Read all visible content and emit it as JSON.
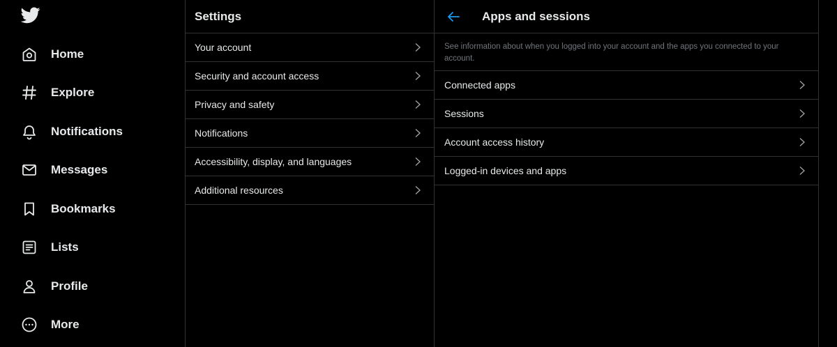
{
  "nav": {
    "logo_icon": "twitter-bird-icon",
    "items": [
      {
        "label": "Home",
        "icon": "home-icon"
      },
      {
        "label": "Explore",
        "icon": "hashtag-icon"
      },
      {
        "label": "Notifications",
        "icon": "bell-icon"
      },
      {
        "label": "Messages",
        "icon": "envelope-icon"
      },
      {
        "label": "Bookmarks",
        "icon": "bookmark-icon"
      },
      {
        "label": "Lists",
        "icon": "list-icon"
      },
      {
        "label": "Profile",
        "icon": "person-icon"
      },
      {
        "label": "More",
        "icon": "more-circle-icon"
      }
    ]
  },
  "settings": {
    "title": "Settings",
    "items": [
      {
        "label": "Your account"
      },
      {
        "label": "Security and account access"
      },
      {
        "label": "Privacy and safety"
      },
      {
        "label": "Notifications"
      },
      {
        "label": "Accessibility, display, and languages"
      },
      {
        "label": "Additional resources"
      }
    ]
  },
  "detail": {
    "title": "Apps and sessions",
    "description": "See information about when you logged into your account and the apps you connected to your account.",
    "items": [
      {
        "label": "Connected apps"
      },
      {
        "label": "Sessions"
      },
      {
        "label": "Account access history"
      },
      {
        "label": "Logged-in devices and apps"
      }
    ]
  },
  "colors": {
    "background": "#000000",
    "text": "#e7e9ea",
    "secondary_text": "#71767b",
    "divider": "#2f3336",
    "accent": "#1d9bf0"
  }
}
